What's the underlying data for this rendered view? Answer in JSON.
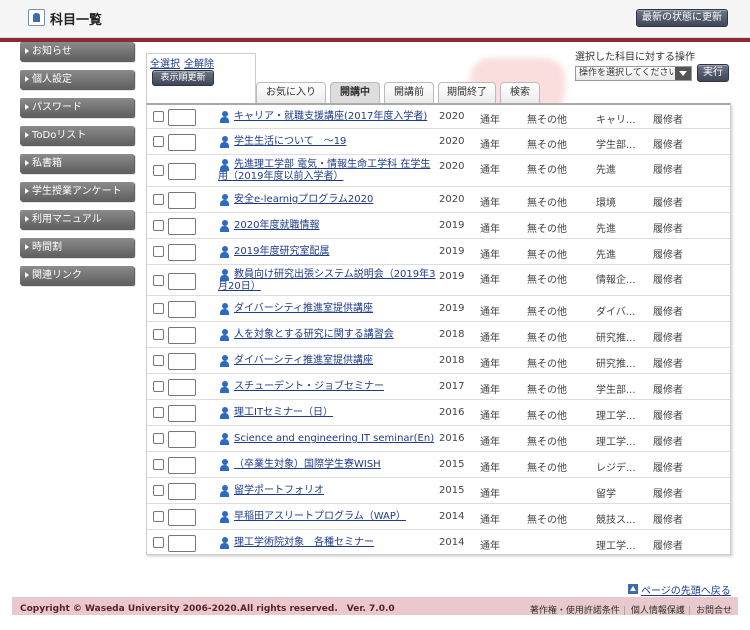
{
  "header": {
    "title": "科目一覧",
    "refresh_label": "最新の状態に更新"
  },
  "sidebar": {
    "items": [
      {
        "label": "お知らせ"
      },
      {
        "label": "個人設定"
      },
      {
        "label": "パスワード"
      },
      {
        "label": "ToDoリスト"
      },
      {
        "label": "私書箱"
      },
      {
        "label": "学生授業アンケート"
      },
      {
        "label": "利用マニュアル"
      },
      {
        "label": "時間割"
      },
      {
        "label": "関連リンク"
      }
    ]
  },
  "controls": {
    "select_all": "全選択",
    "deselect_all": "全解除",
    "display_order": "表示順更新",
    "ops_label": "選択した科目に対する操作",
    "ops_placeholder": "操作を選択してください",
    "execute": "実行"
  },
  "tabs": [
    {
      "label": "お気に入り",
      "active": false
    },
    {
      "label": "開講中",
      "active": true
    },
    {
      "label": "開講前",
      "active": false
    },
    {
      "label": "期間終了",
      "active": false
    },
    {
      "label": "検索",
      "active": false
    }
  ],
  "courses": [
    {
      "name": "キャリア・就職支援講座(2017年度入学者)",
      "year": "2020",
      "term": "通年",
      "day": "無その他",
      "place": "キャリ...",
      "role": "履修者"
    },
    {
      "name": "学生生活について　～19",
      "year": "2020",
      "term": "通年",
      "day": "無その他",
      "place": "学生部...",
      "role": "履修者"
    },
    {
      "name": "先進理工学部 電気・情報生命工学科 在学生用（2019年度以前入学者）",
      "year": "2020",
      "term": "通年",
      "day": "無その他",
      "place": "先進",
      "role": "履修者"
    },
    {
      "name": "安全e-learnigプログラム2020",
      "year": "2020",
      "term": "通年",
      "day": "無その他",
      "place": "環境",
      "role": "履修者"
    },
    {
      "name": "2020年度就職情報",
      "year": "2019",
      "term": "通年",
      "day": "無その他",
      "place": "先進",
      "role": "履修者"
    },
    {
      "name": "2019年度研究室配属",
      "year": "2019",
      "term": "通年",
      "day": "無その他",
      "place": "先進",
      "role": "履修者"
    },
    {
      "name": "教員向け研究出張システム説明会（2019年3月20日）",
      "year": "2019",
      "term": "通年",
      "day": "無その他",
      "place": "情報企...",
      "role": "履修者"
    },
    {
      "name": "ダイバーシティ推進室提供講座",
      "year": "2019",
      "term": "通年",
      "day": "無その他",
      "place": "ダイバ...",
      "role": "履修者"
    },
    {
      "name": "人を対象とする研究に関する講習会",
      "year": "2018",
      "term": "通年",
      "day": "無その他",
      "place": "研究推...",
      "role": "履修者"
    },
    {
      "name": "ダイバーシティ推進室提供講座",
      "year": "2018",
      "term": "通年",
      "day": "無その他",
      "place": "研究推...",
      "role": "履修者"
    },
    {
      "name": "スチューデント・ジョブセミナー",
      "year": "2017",
      "term": "通年",
      "day": "無その他",
      "place": "学生部...",
      "role": "履修者"
    },
    {
      "name": "理工ITセミナー（日）",
      "year": "2016",
      "term": "通年",
      "day": "無その他",
      "place": "理工学...",
      "role": "履修者"
    },
    {
      "name": "Science and engineering IT seminar(En)",
      "year": "2016",
      "term": "通年",
      "day": "無その他",
      "place": "理工学...",
      "role": "履修者"
    },
    {
      "name": "（卒業生対象）国際学生寮WISH",
      "year": "2015",
      "term": "通年",
      "day": "無その他",
      "place": "レジデ...",
      "role": "履修者"
    },
    {
      "name": "留学ポートフォリオ",
      "year": "2015",
      "term": "通年",
      "day": "",
      "place": "留学",
      "role": "履修者"
    },
    {
      "name": "早稲田アスリートプログラム（WAP）",
      "year": "2014",
      "term": "通年",
      "day": "無その他",
      "place": "競技ス...",
      "role": "履修者"
    },
    {
      "name": "理工学術院対象　各種セミナー",
      "year": "2014",
      "term": "通年",
      "day": "",
      "place": "理工学...",
      "role": "履修者"
    }
  ],
  "footer": {
    "page_top": "ページの先頭へ戻る",
    "copyright": "Copyright © Waseda University 2006-2020.All rights reserved.　Ver. 7.0.0",
    "links": [
      "著作権・使用許諾条件",
      "個人情報保護",
      "お問合せ"
    ]
  },
  "colors": {
    "accent_red": "#8f2a35",
    "link_blue": "#1f3c8a",
    "footer_band": "#e9c9cd"
  }
}
